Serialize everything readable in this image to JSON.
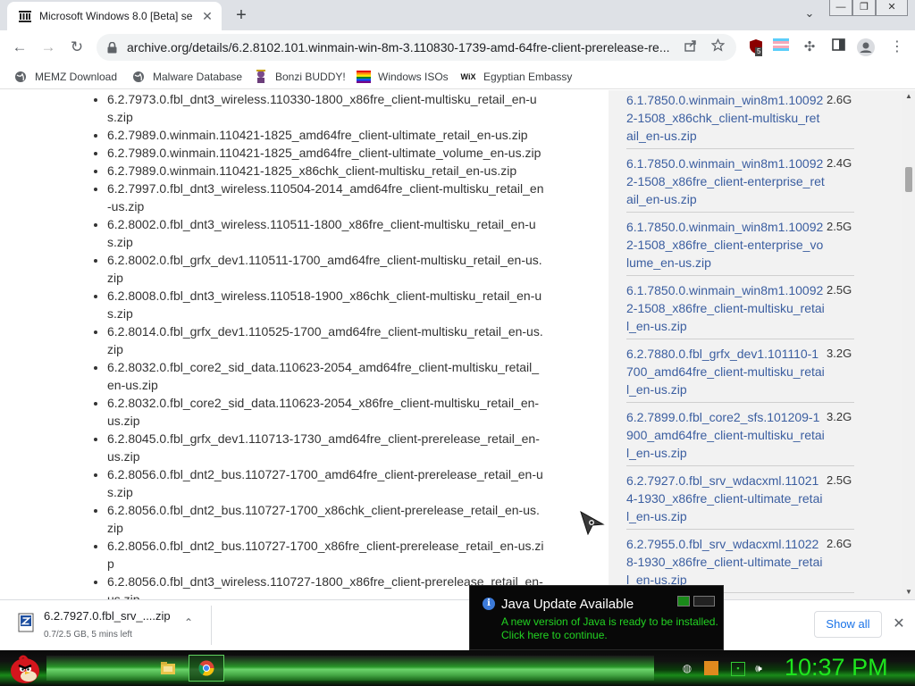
{
  "browser": {
    "tab": {
      "title": "Microsoft Windows 8.0 [Beta] se",
      "close_glyph": "✕"
    },
    "new_tab_glyph": "+",
    "tab_search_glyph": "⌄",
    "window_controls": {
      "minimize": "—",
      "restore": "❐",
      "close": "✕"
    },
    "nav": {
      "back": "←",
      "forward": "→",
      "reload": "↻"
    },
    "url": "archive.org/details/6.2.8102.101.winmain-win-8m-3.110830-1739-amd-64fre-client-prerelease-re...",
    "extension_badge": "5",
    "bookmarks": [
      {
        "label": "MEMZ Download",
        "icon": "globe-icon"
      },
      {
        "label": "Malware Database",
        "icon": "globe-icon"
      },
      {
        "label": "Bonzi BUDDY!",
        "icon": "bonzi-icon"
      },
      {
        "label": "Windows ISOs",
        "icon": "rainbow-flag-icon"
      },
      {
        "label": "Egyptian Embassy",
        "icon": "wix-icon"
      }
    ],
    "wix_glyph": "WiX"
  },
  "file_list": [
    "6.2.7973.0.fbl_dnt3_wireless.110330-1800_x86fre_client-multisku_retail_en-us.zip",
    "6.2.7989.0.winmain.110421-1825_amd64fre_client-ultimate_retail_en-us.zip",
    "6.2.7989.0.winmain.110421-1825_amd64fre_client-ultimate_volume_en-us.zip",
    "6.2.7989.0.winmain.110421-1825_x86chk_client-multisku_retail_en-us.zip",
    "6.2.7997.0.fbl_dnt3_wireless.110504-2014_amd64fre_client-multisku_retail_en-us.zip",
    "6.2.8002.0.fbl_dnt3_wireless.110511-1800_x86fre_client-multisku_retail_en-us.zip",
    "6.2.8002.0.fbl_grfx_dev1.110511-1700_amd64fre_client-multisku_retail_en-us.zip",
    "6.2.8008.0.fbl_dnt3_wireless.110518-1900_x86chk_client-multisku_retail_en-us.zip",
    "6.2.8014.0.fbl_grfx_dev1.110525-1700_amd64fre_client-multisku_retail_en-us.zip",
    "6.2.8032.0.fbl_core2_sid_data.110623-2054_amd64fre_client-multisku_retail_en-us.zip",
    "6.2.8032.0.fbl_core2_sid_data.110623-2054_x86fre_client-multisku_retail_en-us.zip",
    "6.2.8045.0.fbl_grfx_dev1.110713-1730_amd64fre_client-prerelease_retail_en-us.zip",
    "6.2.8056.0.fbl_dnt2_bus.110727-1700_amd64fre_client-prerelease_retail_en-us.zip",
    "6.2.8056.0.fbl_dnt2_bus.110727-1700_x86chk_client-prerelease_retail_en-us.zip",
    "6.2.8056.0.fbl_dnt2_bus.110727-1700_x86fre_client-prerelease_retail_en-us.zip",
    "6.2.8056.0.fbl_dnt3_wireless.110727-1800_x86fre_client-prerelease_retail_en-us.zip"
  ],
  "related": [
    {
      "name": "6.1.7850.0.winmain_win8m1.100922-1508_x86chk_client-multisku_retail_en-us.zip",
      "size": "2.6G"
    },
    {
      "name": "6.1.7850.0.winmain_win8m1.100922-1508_x86fre_client-enterprise_retail_en-us.zip",
      "size": "2.4G"
    },
    {
      "name": "6.1.7850.0.winmain_win8m1.100922-1508_x86fre_client-enterprise_volume_en-us.zip",
      "size": "2.5G"
    },
    {
      "name": "6.1.7850.0.winmain_win8m1.100922-1508_x86fre_client-multisku_retail_en-us.zip",
      "size": "2.5G"
    },
    {
      "name": "6.2.7880.0.fbl_grfx_dev1.101110-1700_amd64fre_client-multisku_retail_en-us.zip",
      "size": "3.2G"
    },
    {
      "name": "6.2.7899.0.fbl_core2_sfs.101209-1900_amd64fre_client-multisku_retail_en-us.zip",
      "size": "3.2G"
    },
    {
      "name": "6.2.7927.0.fbl_srv_wdacxml.110214-1930_x86fre_client-ultimate_retail_en-us.zip",
      "size": "2.5G"
    },
    {
      "name": "6.2.7955.0.fbl_srv_wdacxml.110228-1930_x86fre_client-ultimate_retail_en-us.zip",
      "size": "2.6G"
    }
  ],
  "download_shelf": {
    "item": {
      "name": "6.2.7927.0.fbl_srv_....zip",
      "status": "0.7/2.5 GB, 5 mins left",
      "chevron": "⌃"
    },
    "show_all": "Show all",
    "close": "✕"
  },
  "java_popup": {
    "title": "Java Update Available",
    "message": "A new version of Java is ready to be installed. Click here to continue.",
    "info_glyph": "i"
  },
  "taskbar": {
    "clock": "10:37 PM"
  }
}
